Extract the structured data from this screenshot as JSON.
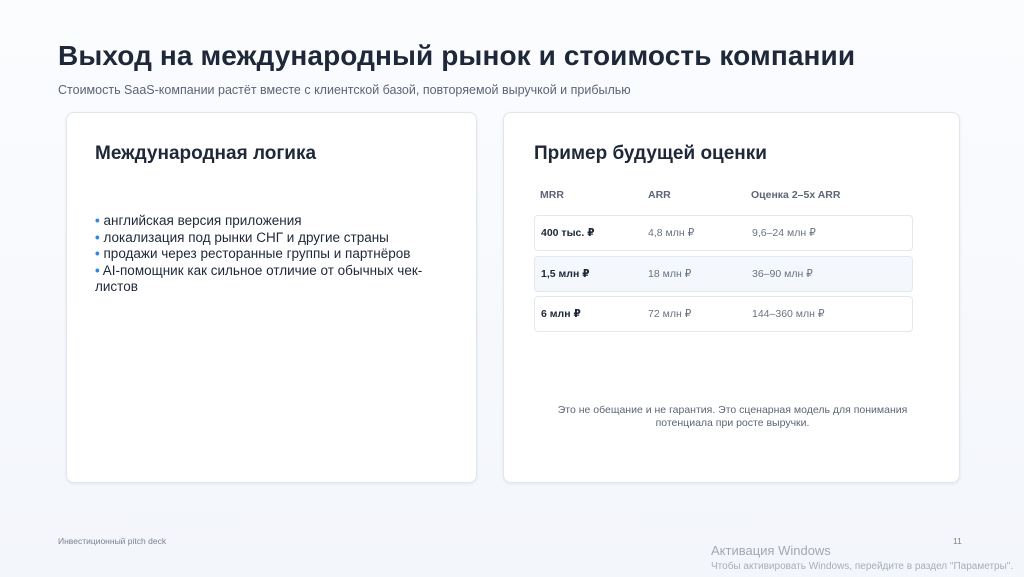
{
  "slide": {
    "title": "Выход на международный рынок и стоимость компании",
    "subtitle": "Стоимость SaaS-компании растёт вместе с клиентской базой, повторяемой выручкой и прибылью"
  },
  "left_card": {
    "title": "Международная логика",
    "bullet_marker": "•",
    "bullets": [
      "английская версия приложения",
      "локализация под рынки СНГ и другие страны",
      "продажи через ресторанные группы и партнёров",
      "AI-помощник как сильное отличие от обычных чек-листов"
    ]
  },
  "right_card": {
    "title": "Пример будущей оценки",
    "columns": [
      "MRR",
      "ARR",
      "Оценка 2–5x ARR"
    ],
    "rows": [
      {
        "mrr": "400 тыс. ₽",
        "arr": "4,8 млн ₽",
        "valuation": "9,6–24 млн ₽"
      },
      {
        "mrr": "1,5 млн ₽",
        "arr": "18 млн ₽",
        "valuation": "36–90 млн ₽"
      },
      {
        "mrr": "6 млн ₽",
        "arr": "72 млн ₽",
        "valuation": "144–360 млн ₽"
      }
    ],
    "note": "Это не обещание и не гарантия. Это сценарная модель для понимания потенциала при росте выручки."
  },
  "footer": {
    "label": "Инвестиционный pitch deck",
    "page_number": "11"
  },
  "os_watermark": {
    "title": "Активация Windows",
    "subtitle": "Чтобы активировать Windows, перейдите в раздел \"Параметры\"."
  },
  "colors": {
    "accent": "#2e86de",
    "title_text": "#1f2838",
    "muted_text": "#5c6676",
    "card_border": "#e1e6ee",
    "alt_row_bg": "#f4f8fd"
  }
}
